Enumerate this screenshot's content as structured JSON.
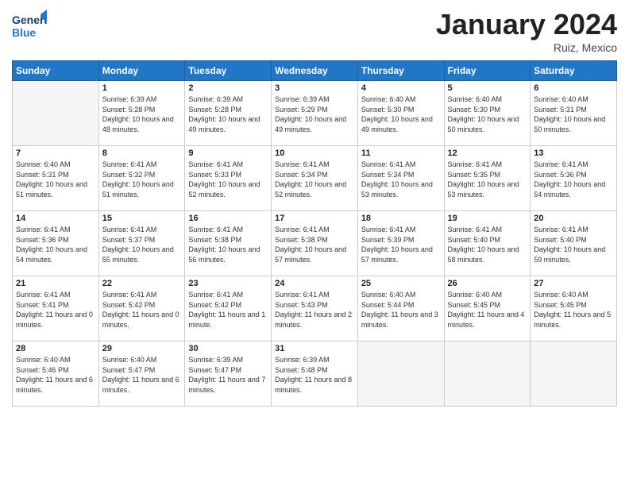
{
  "header": {
    "logo_general": "General",
    "logo_blue": "Blue",
    "month_title": "January 2024",
    "location": "Ruiz, Mexico"
  },
  "weekdays": [
    "Sunday",
    "Monday",
    "Tuesday",
    "Wednesday",
    "Thursday",
    "Friday",
    "Saturday"
  ],
  "weeks": [
    [
      {
        "day": "",
        "sunrise": "",
        "sunset": "",
        "daylight": "",
        "empty": true
      },
      {
        "day": "1",
        "sunrise": "Sunrise: 6:39 AM",
        "sunset": "Sunset: 5:28 PM",
        "daylight": "Daylight: 10 hours and 48 minutes."
      },
      {
        "day": "2",
        "sunrise": "Sunrise: 6:39 AM",
        "sunset": "Sunset: 5:28 PM",
        "daylight": "Daylight: 10 hours and 49 minutes."
      },
      {
        "day": "3",
        "sunrise": "Sunrise: 6:39 AM",
        "sunset": "Sunset: 5:29 PM",
        "daylight": "Daylight: 10 hours and 49 minutes."
      },
      {
        "day": "4",
        "sunrise": "Sunrise: 6:40 AM",
        "sunset": "Sunset: 5:30 PM",
        "daylight": "Daylight: 10 hours and 49 minutes."
      },
      {
        "day": "5",
        "sunrise": "Sunrise: 6:40 AM",
        "sunset": "Sunset: 5:30 PM",
        "daylight": "Daylight: 10 hours and 50 minutes."
      },
      {
        "day": "6",
        "sunrise": "Sunrise: 6:40 AM",
        "sunset": "Sunset: 5:31 PM",
        "daylight": "Daylight: 10 hours and 50 minutes."
      }
    ],
    [
      {
        "day": "7",
        "sunrise": "Sunrise: 6:40 AM",
        "sunset": "Sunset: 5:31 PM",
        "daylight": "Daylight: 10 hours and 51 minutes."
      },
      {
        "day": "8",
        "sunrise": "Sunrise: 6:41 AM",
        "sunset": "Sunset: 5:32 PM",
        "daylight": "Daylight: 10 hours and 51 minutes."
      },
      {
        "day": "9",
        "sunrise": "Sunrise: 6:41 AM",
        "sunset": "Sunset: 5:33 PM",
        "daylight": "Daylight: 10 hours and 52 minutes."
      },
      {
        "day": "10",
        "sunrise": "Sunrise: 6:41 AM",
        "sunset": "Sunset: 5:34 PM",
        "daylight": "Daylight: 10 hours and 52 minutes."
      },
      {
        "day": "11",
        "sunrise": "Sunrise: 6:41 AM",
        "sunset": "Sunset: 5:34 PM",
        "daylight": "Daylight: 10 hours and 53 minutes."
      },
      {
        "day": "12",
        "sunrise": "Sunrise: 6:41 AM",
        "sunset": "Sunset: 5:35 PM",
        "daylight": "Daylight: 10 hours and 53 minutes."
      },
      {
        "day": "13",
        "sunrise": "Sunrise: 6:41 AM",
        "sunset": "Sunset: 5:36 PM",
        "daylight": "Daylight: 10 hours and 54 minutes."
      }
    ],
    [
      {
        "day": "14",
        "sunrise": "Sunrise: 6:41 AM",
        "sunset": "Sunset: 5:36 PM",
        "daylight": "Daylight: 10 hours and 54 minutes."
      },
      {
        "day": "15",
        "sunrise": "Sunrise: 6:41 AM",
        "sunset": "Sunset: 5:37 PM",
        "daylight": "Daylight: 10 hours and 55 minutes."
      },
      {
        "day": "16",
        "sunrise": "Sunrise: 6:41 AM",
        "sunset": "Sunset: 5:38 PM",
        "daylight": "Daylight: 10 hours and 56 minutes."
      },
      {
        "day": "17",
        "sunrise": "Sunrise: 6:41 AM",
        "sunset": "Sunset: 5:38 PM",
        "daylight": "Daylight: 10 hours and 57 minutes."
      },
      {
        "day": "18",
        "sunrise": "Sunrise: 6:41 AM",
        "sunset": "Sunset: 5:39 PM",
        "daylight": "Daylight: 10 hours and 57 minutes."
      },
      {
        "day": "19",
        "sunrise": "Sunrise: 6:41 AM",
        "sunset": "Sunset: 5:40 PM",
        "daylight": "Daylight: 10 hours and 58 minutes."
      },
      {
        "day": "20",
        "sunrise": "Sunrise: 6:41 AM",
        "sunset": "Sunset: 5:40 PM",
        "daylight": "Daylight: 10 hours and 59 minutes."
      }
    ],
    [
      {
        "day": "21",
        "sunrise": "Sunrise: 6:41 AM",
        "sunset": "Sunset: 5:41 PM",
        "daylight": "Daylight: 11 hours and 0 minutes."
      },
      {
        "day": "22",
        "sunrise": "Sunrise: 6:41 AM",
        "sunset": "Sunset: 5:42 PM",
        "daylight": "Daylight: 11 hours and 0 minutes."
      },
      {
        "day": "23",
        "sunrise": "Sunrise: 6:41 AM",
        "sunset": "Sunset: 5:42 PM",
        "daylight": "Daylight: 11 hours and 1 minute."
      },
      {
        "day": "24",
        "sunrise": "Sunrise: 6:41 AM",
        "sunset": "Sunset: 5:43 PM",
        "daylight": "Daylight: 11 hours and 2 minutes."
      },
      {
        "day": "25",
        "sunrise": "Sunrise: 6:40 AM",
        "sunset": "Sunset: 5:44 PM",
        "daylight": "Daylight: 11 hours and 3 minutes."
      },
      {
        "day": "26",
        "sunrise": "Sunrise: 6:40 AM",
        "sunset": "Sunset: 5:45 PM",
        "daylight": "Daylight: 11 hours and 4 minutes."
      },
      {
        "day": "27",
        "sunrise": "Sunrise: 6:40 AM",
        "sunset": "Sunset: 5:45 PM",
        "daylight": "Daylight: 11 hours and 5 minutes."
      }
    ],
    [
      {
        "day": "28",
        "sunrise": "Sunrise: 6:40 AM",
        "sunset": "Sunset: 5:46 PM",
        "daylight": "Daylight: 11 hours and 6 minutes."
      },
      {
        "day": "29",
        "sunrise": "Sunrise: 6:40 AM",
        "sunset": "Sunset: 5:47 PM",
        "daylight": "Daylight: 11 hours and 6 minutes."
      },
      {
        "day": "30",
        "sunrise": "Sunrise: 6:39 AM",
        "sunset": "Sunset: 5:47 PM",
        "daylight": "Daylight: 11 hours and 7 minutes."
      },
      {
        "day": "31",
        "sunrise": "Sunrise: 6:39 AM",
        "sunset": "Sunset: 5:48 PM",
        "daylight": "Daylight: 11 hours and 8 minutes."
      },
      {
        "day": "",
        "sunrise": "",
        "sunset": "",
        "daylight": "",
        "empty": true
      },
      {
        "day": "",
        "sunrise": "",
        "sunset": "",
        "daylight": "",
        "empty": true
      },
      {
        "day": "",
        "sunrise": "",
        "sunset": "",
        "daylight": "",
        "empty": true
      }
    ]
  ]
}
